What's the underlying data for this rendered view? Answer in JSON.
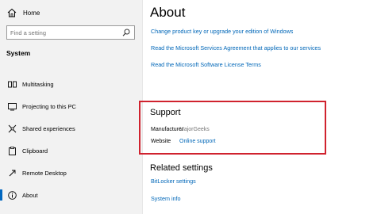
{
  "sidebar": {
    "home_label": "Home",
    "search_placeholder": "Find a setting",
    "section_title": "System",
    "items": [
      {
        "label": "Multitasking",
        "icon": "multitasking-icon"
      },
      {
        "label": "Projecting to this PC",
        "icon": "projecting-icon"
      },
      {
        "label": "Shared experiences",
        "icon": "shared-experiences-icon"
      },
      {
        "label": "Clipboard",
        "icon": "clipboard-icon"
      },
      {
        "label": "Remote Desktop",
        "icon": "remote-desktop-icon"
      },
      {
        "label": "About",
        "icon": "about-icon",
        "active": true
      }
    ]
  },
  "main": {
    "title": "About",
    "links": [
      "Change product key or upgrade your edition of Windows",
      "Read the Microsoft Services Agreement that applies to our services",
      "Read the Microsoft Software License Terms"
    ],
    "support": {
      "title": "Support",
      "rows": [
        {
          "label": "Manufacturer",
          "value": "MajorGeeks"
        },
        {
          "label": "Website",
          "value": "Online support"
        }
      ]
    },
    "related": {
      "title": "Related settings",
      "links": [
        "BitLocker settings",
        "System info"
      ]
    }
  },
  "colors": {
    "accent": "#0067b8",
    "highlight_border": "#d0222e",
    "sidebar_bg": "#f2f2f2"
  }
}
